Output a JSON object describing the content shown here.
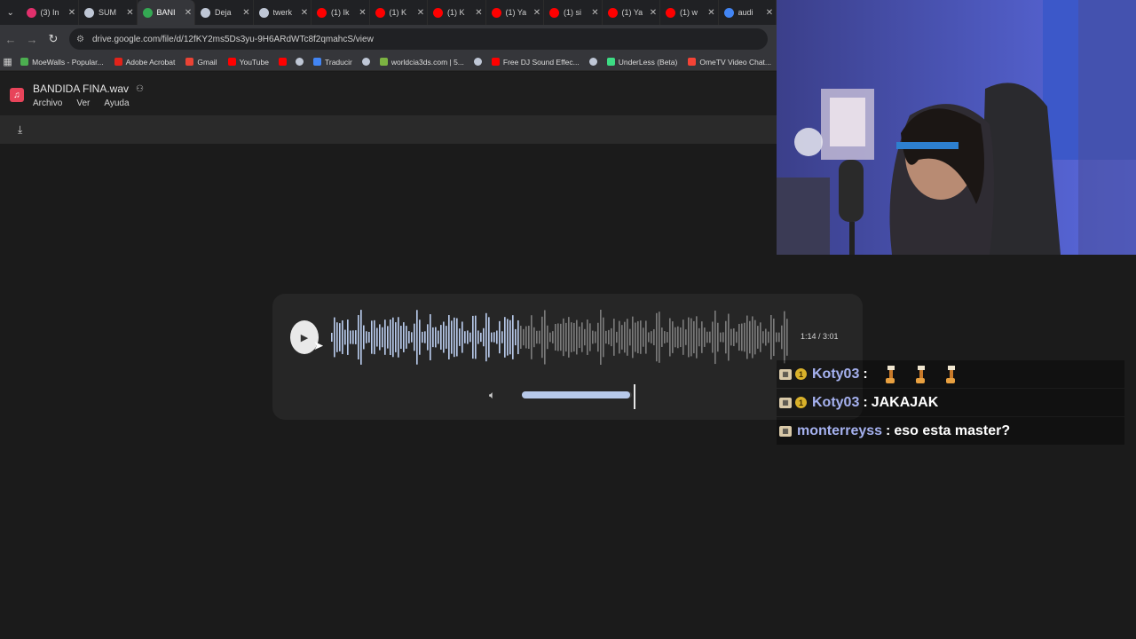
{
  "browser": {
    "tabs": [
      {
        "label": "(3) In",
        "icon": "instagram-icon",
        "color": "#e1306c",
        "active": false
      },
      {
        "label": "SUM",
        "icon": "globe-icon",
        "color": "#bfc7d6",
        "active": false
      },
      {
        "label": "BANI",
        "icon": "google-drive-icon",
        "color": "#34a853",
        "active": true
      },
      {
        "label": "Deja",
        "icon": "globe-icon",
        "color": "#bfc7d6",
        "active": false
      },
      {
        "label": "twerk",
        "icon": "globe-icon",
        "color": "#bfc7d6",
        "active": false
      },
      {
        "label": "(1) Ik",
        "icon": "youtube-icon",
        "color": "#ff0000",
        "active": false
      },
      {
        "label": "(1) K",
        "icon": "youtube-icon",
        "color": "#ff0000",
        "active": false
      },
      {
        "label": "(1) K",
        "icon": "youtube-icon",
        "color": "#ff0000",
        "active": false
      },
      {
        "label": "(1) Ya",
        "icon": "youtube-icon",
        "color": "#ff0000",
        "active": false
      },
      {
        "label": "(1) si",
        "icon": "youtube-icon",
        "color": "#ff0000",
        "active": false
      },
      {
        "label": "(1) Ya",
        "icon": "youtube-icon",
        "color": "#ff0000",
        "active": false
      },
      {
        "label": "(1) w",
        "icon": "youtube-icon",
        "color": "#ff0000",
        "active": false
      },
      {
        "label": "audi",
        "icon": "google-icon",
        "color": "#4285f4",
        "active": false
      }
    ],
    "url": "drive.google.com/file/d/12fKY2ms5Ds3yu-9H6ARdWTc8f2qmahcS/view",
    "bookmarks": [
      {
        "label": "MoeWalls - Popular...",
        "icon": "moewalls-icon",
        "color": "#4caf50"
      },
      {
        "label": "Adobe Acrobat",
        "icon": "acrobat-icon",
        "color": "#e2231a"
      },
      {
        "label": "Gmail",
        "icon": "gmail-icon",
        "color": "#ea4335"
      },
      {
        "label": "YouTube",
        "icon": "youtube-icon",
        "color": "#ff0000"
      },
      {
        "label": "",
        "icon": "youtube-icon",
        "color": "#ff0000"
      },
      {
        "label": "",
        "icon": "globe-icon",
        "color": "#bfc7d6"
      },
      {
        "label": "Traducir",
        "icon": "translate-icon",
        "color": "#4285f4"
      },
      {
        "label": "",
        "icon": "globe-icon",
        "color": "#bfc7d6"
      },
      {
        "label": "worldcia3ds.com | 5...",
        "icon": "worldcia-icon",
        "color": "#7cb342"
      },
      {
        "label": "",
        "icon": "globe-icon",
        "color": "#bfc7d6"
      },
      {
        "label": "Free DJ Sound Effec...",
        "icon": "youtube-icon",
        "color": "#ff0000"
      },
      {
        "label": "",
        "icon": "globe-icon",
        "color": "#bfc7d6"
      },
      {
        "label": "UnderLess (Beta)",
        "icon": "underless-icon",
        "color": "#3ddc84"
      },
      {
        "label": "OmeTV Video Chat...",
        "icon": "ometv-icon",
        "color": "#f44336"
      }
    ]
  },
  "viewer": {
    "file_name": "BANDIDA FINA.wav",
    "menu": [
      "Archivo",
      "Ver",
      "Ayuda"
    ]
  },
  "player": {
    "time": "1:14 / 3:01",
    "progress": 0.41,
    "volume": 0.98
  },
  "chat": [
    {
      "user": "Koty03",
      "message": "",
      "badges": [
        "clapper",
        "one"
      ],
      "emotes": 3
    },
    {
      "user": "Koty03",
      "message": "JAKAJAK",
      "badges": [
        "clapper",
        "one"
      ],
      "emotes": 0
    },
    {
      "user": "monterreyss",
      "message": "eso esta master?",
      "badges": [
        "clapper"
      ],
      "emotes": 0
    }
  ],
  "colors": {
    "accent": "#b7c9ea",
    "chat_user": "#a5b1ef",
    "drive_icon": "#e8445a"
  }
}
